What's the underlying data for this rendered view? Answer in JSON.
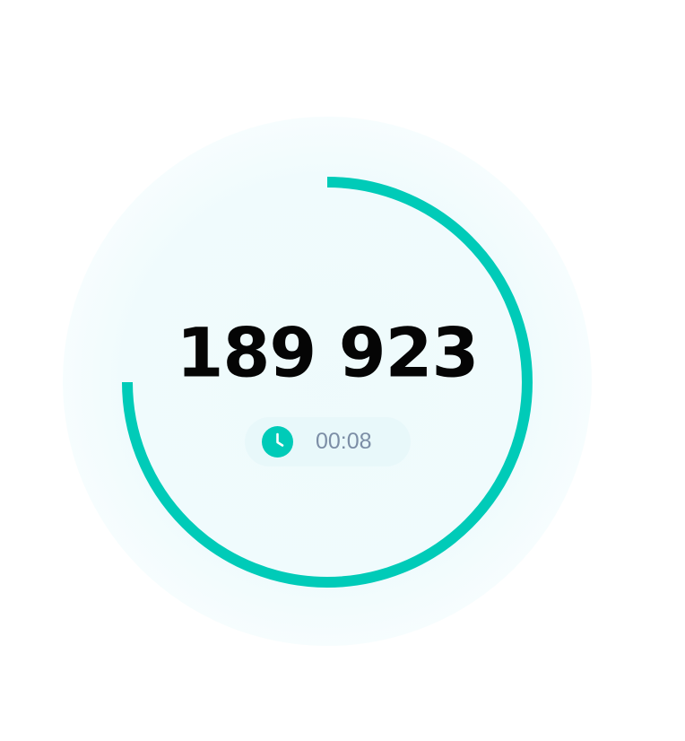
{
  "counter": {
    "value": "189 923",
    "progress": 0.75
  },
  "timer": {
    "elapsed": "00:08",
    "icon": "clock-icon"
  },
  "colors": {
    "accent": "#00cbb8",
    "halo": "#e6f8fb",
    "pill": "#e8f8fa",
    "timer_text": "#7c8ea6",
    "value_text": "#050505"
  }
}
